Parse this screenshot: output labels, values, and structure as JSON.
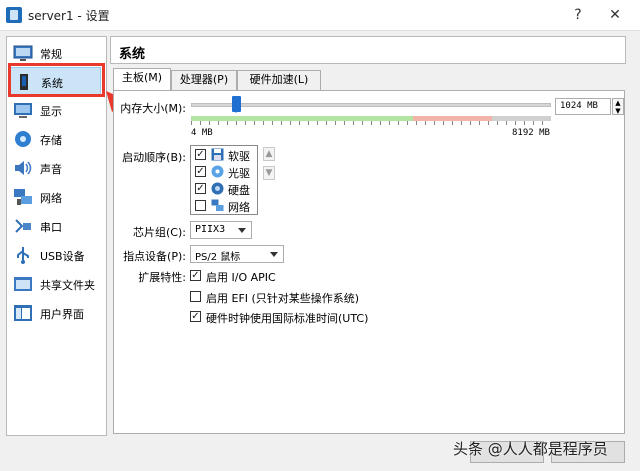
{
  "window": {
    "title": "server1 - 设置",
    "help_label": "?",
    "close_label": "✕"
  },
  "sidebar": {
    "items": [
      {
        "label": "常规",
        "icon": "general-icon"
      },
      {
        "label": "系统",
        "icon": "system-icon",
        "selected": true
      },
      {
        "label": "显示",
        "icon": "display-icon"
      },
      {
        "label": "存储",
        "icon": "storage-icon"
      },
      {
        "label": "声音",
        "icon": "audio-icon"
      },
      {
        "label": "网络",
        "icon": "network-icon"
      },
      {
        "label": "串口",
        "icon": "serial-port-icon"
      },
      {
        "label": "USB设备",
        "icon": "usb-icon"
      },
      {
        "label": "共享文件夹",
        "icon": "shared-folder-icon"
      },
      {
        "label": "用户界面",
        "icon": "user-interface-icon"
      }
    ]
  },
  "section": {
    "title": "系统"
  },
  "tabs": [
    {
      "label": "主板(M)",
      "active": true
    },
    {
      "label": "处理器(P)",
      "active": false
    },
    {
      "label": "硬件加速(L)",
      "active": false
    }
  ],
  "motherboard": {
    "memory": {
      "label": "内存大小(M):",
      "value": "1024 MB",
      "min_label": "4 MB",
      "max_label": "8192 MB",
      "fraction": 0.125
    },
    "boot_order": {
      "label": "启动顺序(B):",
      "items": [
        {
          "label": "软驱",
          "checked": true,
          "icon": "floppy-icon"
        },
        {
          "label": "光驱",
          "checked": true,
          "icon": "optical-drive-icon"
        },
        {
          "label": "硬盘",
          "checked": true,
          "icon": "hard-disk-icon"
        },
        {
          "label": "网络",
          "checked": false,
          "icon": "network-boot-icon"
        }
      ]
    },
    "chipset": {
      "label": "芯片组(C):",
      "value": "PIIX3"
    },
    "pointing_device": {
      "label": "指点设备(P):",
      "value": "PS/2 鼠标"
    },
    "extended_features": {
      "label": "扩展特性:",
      "options": [
        {
          "label": "启用 I/O APIC",
          "checked": true
        },
        {
          "label": "启用 EFI (只针对某些操作系统)",
          "checked": false
        },
        {
          "label": "硬件时钟使用国际标准时间(UTC)",
          "checked": true
        }
      ]
    }
  },
  "watermark": "头条 @人人都是程序员",
  "colors": {
    "highlight": "#e8392c",
    "selection": "#cce4f7",
    "slider_thumb": "#1f6fd0"
  }
}
